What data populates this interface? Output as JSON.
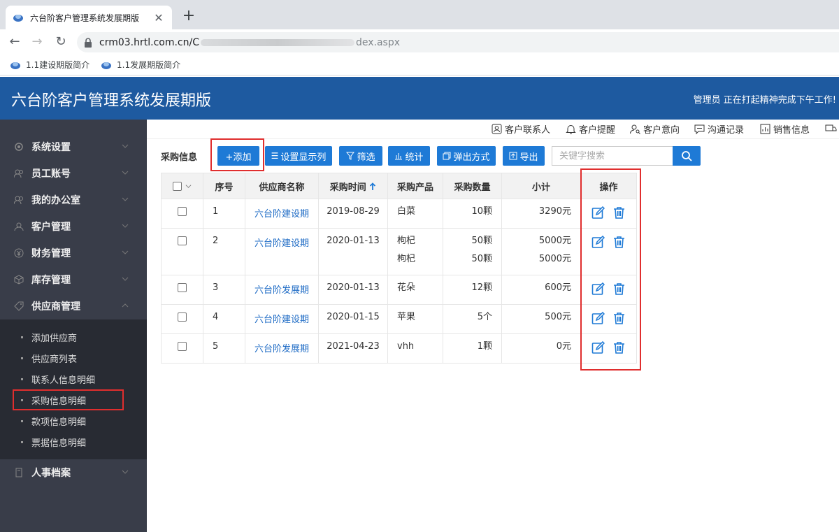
{
  "browser": {
    "tab_title": "六台阶客户管理系统发展期版",
    "url_host": "crm03.hrtl.com.cn/C",
    "url_path": "dex.aspx",
    "bookmarks": [
      "1.1建设期版简介",
      "1.1发展期版简介"
    ]
  },
  "app": {
    "title": "六台阶客户管理系统发展期版",
    "user_message": "管理员 正在打起精神完成下午工作!"
  },
  "sidebar": {
    "menus": [
      {
        "label": "系统设置",
        "icon": "gear-icon"
      },
      {
        "label": "员工账号",
        "icon": "users-icon"
      },
      {
        "label": "我的办公室",
        "icon": "users-icon"
      },
      {
        "label": "客户管理",
        "icon": "user-icon"
      },
      {
        "label": "财务管理",
        "icon": "yen-icon"
      },
      {
        "label": "库存管理",
        "icon": "box-icon"
      },
      {
        "label": "供应商管理",
        "icon": "tag-icon"
      }
    ],
    "submenu": [
      "添加供应商",
      "供应商列表",
      "联系人信息明细",
      "采购信息明细",
      "款项信息明细",
      "票据信息明细"
    ],
    "bottom_menu": {
      "label": "人事档案",
      "icon": "file-icon"
    }
  },
  "toolnav": [
    "客户联系人",
    "客户提醒",
    "客户意向",
    "沟通记录",
    "销售信息"
  ],
  "toolbar": {
    "page_label": "采购信息",
    "buttons": [
      "+添加",
      "设置显示列",
      "筛选",
      "统计",
      "弹出方式",
      "导出"
    ],
    "search_placeholder": "关键字搜索"
  },
  "table": {
    "headers": [
      "序号",
      "供应商名称",
      "采购时间",
      "采购产品",
      "采购数量",
      "小计",
      "操作"
    ],
    "rows": [
      {
        "no": "1",
        "supplier": "六台阶建设期",
        "date": "2019-08-29",
        "products": [
          "白菜"
        ],
        "qty": [
          "10颗"
        ],
        "subtotal": [
          "3290元"
        ]
      },
      {
        "no": "2",
        "supplier": "六台阶建设期",
        "date": "2020-01-13",
        "products": [
          "枸杞",
          "枸杞"
        ],
        "qty": [
          "50颗",
          "50颗"
        ],
        "subtotal": [
          "5000元",
          "5000元"
        ]
      },
      {
        "no": "3",
        "supplier": "六台阶发展期",
        "date": "2020-01-13",
        "products": [
          "花朵"
        ],
        "qty": [
          "12颗"
        ],
        "subtotal": [
          "600元"
        ]
      },
      {
        "no": "4",
        "supplier": "六台阶建设期",
        "date": "2020-01-15",
        "products": [
          "苹果"
        ],
        "qty": [
          "5个"
        ],
        "subtotal": [
          "500元"
        ]
      },
      {
        "no": "5",
        "supplier": "六台阶发展期",
        "date": "2021-04-23",
        "products": [
          "vhh"
        ],
        "qty": [
          "1颗"
        ],
        "subtotal": [
          "0元"
        ]
      }
    ]
  },
  "colors": {
    "header_blue": "#1e5aa0",
    "button_blue": "#1e7ad6",
    "sidebar": "#393d49",
    "highlight_red": "#e02e2e"
  }
}
